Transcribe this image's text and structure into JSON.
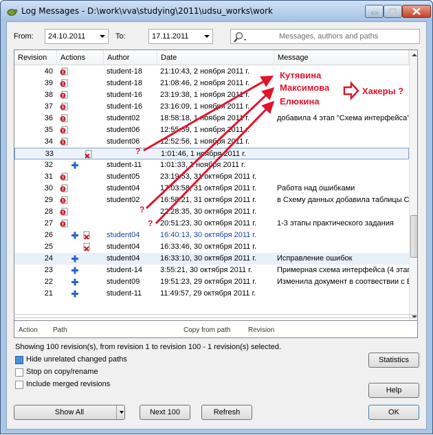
{
  "window": {
    "title": "Log Messages - D:\\work\\vva\\studying\\2011\\udsu_works\\work"
  },
  "filter": {
    "from_label": "From:",
    "from_value": "24.10.2011",
    "to_label": "To:",
    "to_value": "17.11.2011",
    "search_placeholder": "Messages, authors and paths"
  },
  "columns": [
    "Revision",
    "Actions",
    "Author",
    "Date",
    "Message"
  ],
  "rows": [
    {
      "rev": "40",
      "actions": [
        "modified"
      ],
      "author": "student-18",
      "date": "21:10:43, 2 ноября 2011 г.",
      "msg": ""
    },
    {
      "rev": "39",
      "actions": [
        "modified"
      ],
      "author": "student-18",
      "date": "21:08:46, 2 ноября 2011 г.",
      "msg": ""
    },
    {
      "rev": "38",
      "actions": [
        "modified"
      ],
      "author": "student-16",
      "date": "23:19:38, 1 ноября 2011 г.",
      "msg": ""
    },
    {
      "rev": "37",
      "actions": [
        "modified"
      ],
      "author": "student-16",
      "date": "23:16:09, 1 ноября 2011 г.",
      "msg": ""
    },
    {
      "rev": "36",
      "actions": [
        "modified"
      ],
      "author": "student02",
      "date": "18:58:18, 1 ноября 2011 г.",
      "msg": "добавила 4 этап \"Схема интерфейса\""
    },
    {
      "rev": "35",
      "actions": [
        "modified"
      ],
      "author": "student06",
      "date": "12:55:59, 1 ноября 2011 г.",
      "msg": ""
    },
    {
      "rev": "34",
      "actions": [
        "modified"
      ],
      "author": "student06",
      "date": "12:52:56, 1 ноября 2011 г.",
      "msg": ""
    },
    {
      "rev": "33",
      "actions": [
        "replaced"
      ],
      "author": "",
      "date": "1:01:46, 1 ноября 2011 г.",
      "msg": "",
      "selected": true
    },
    {
      "rev": "32",
      "actions": [
        "added"
      ],
      "author": "student-11",
      "date": "1:01:33, 1 ноября 2011 г.",
      "msg": ""
    },
    {
      "rev": "31",
      "actions": [
        "modified"
      ],
      "author": "student05",
      "date": "23:19:53, 31 октября 2011 г.",
      "msg": ""
    },
    {
      "rev": "30",
      "actions": [
        "modified"
      ],
      "author": "student04",
      "date": "17:03:58, 31 октября 2011 г.",
      "msg": "Работа над ошибками"
    },
    {
      "rev": "29",
      "actions": [
        "modified"
      ],
      "author": "student02",
      "date": "16:58:21, 31 октября 2011 г.",
      "msg": "в Схему данных добавила таблицы С"
    },
    {
      "rev": "28",
      "actions": [
        "modified"
      ],
      "author": "",
      "date": "22:28:35, 30 октября 2011 г.",
      "msg": ""
    },
    {
      "rev": "27",
      "actions": [
        "modified"
      ],
      "author": "",
      "date": "20:51:23, 30 октября 2011 г.",
      "msg": "1-3 этапы практического  задания"
    },
    {
      "rev": "26",
      "actions": [
        "added",
        "deleted"
      ],
      "author": "student04",
      "date": "16:40:13, 30 октября 2011 г.",
      "msg": "",
      "blue": true
    },
    {
      "rev": "25",
      "actions": [
        "deleted"
      ],
      "author": "student04",
      "date": "16:33:46, 30 октября 2011 г.",
      "msg": ""
    },
    {
      "rev": "24",
      "actions": [
        "added"
      ],
      "author": "student04",
      "date": "16:33:10, 30 октября 2011 г.",
      "msg": "Исправление ошибок",
      "highlight": true
    },
    {
      "rev": "23",
      "actions": [
        "added"
      ],
      "author": "student-14",
      "date": "3:55:21, 30 октября 2011 г.",
      "msg": "Примерная схема интерфейса (4 этап"
    },
    {
      "rev": "22",
      "actions": [
        "added"
      ],
      "author": "student09",
      "date": "19:51:23, 29 октября 2011 г.",
      "msg": "Изменила документ в соотвествии с Е"
    },
    {
      "rev": "21",
      "actions": [
        "added"
      ],
      "author": "student-11",
      "date": "11:49:57, 29 октября 2011 г.",
      "msg": ""
    }
  ],
  "paths_columns": [
    "Action",
    "Path",
    "Copy from path",
    "Revision"
  ],
  "status_text": "Showing 100 revision(s), from revision 1 to revision 100 - 1 revision(s) selected.",
  "options": {
    "hide_unrelated": "Hide unrelated changed paths",
    "stop_on_copy": "Stop on copy/rename",
    "include_merged": "Include merged revisions"
  },
  "buttons": {
    "statistics": "Statistics",
    "help": "Help",
    "show_all": "Show All",
    "next_100": "Next 100",
    "refresh": "Refresh",
    "ok": "OK"
  },
  "annotations": {
    "name1": "Кутявина",
    "name2": "Максимова",
    "name3": "Елюкина",
    "hackers": "Хакеры ?",
    "q1": "?",
    "q2": "?",
    "q3": "?"
  },
  "colors": {
    "annotation_red": "#e0142c",
    "action_modified": "#c0282c",
    "action_added": "#2a62c9",
    "blue_row_text": "#1a3fa8"
  }
}
